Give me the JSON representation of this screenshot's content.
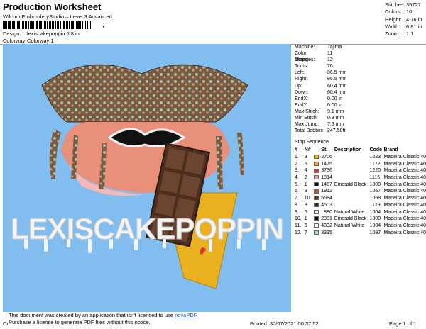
{
  "header": {
    "title": "Production Worksheet",
    "subtitle": "Wilcom EmbroideryStudio – Level 3 Advanced",
    "comma": ",",
    "design_label": "Design:",
    "design_value": "lexiscakepoppin 6,8 in",
    "colorway_label": "Colorway:",
    "colorway_value": "Colorway 1"
  },
  "stats": [
    {
      "label": "Stitches:",
      "value": "35727"
    },
    {
      "label": "Colors:",
      "value": "10"
    },
    {
      "label": "Height:",
      "value": "4.76 in"
    },
    {
      "label": "Width:",
      "value": "6.81 in"
    },
    {
      "label": "Zoom:",
      "value": "1:1"
    }
  ],
  "machine_info": [
    {
      "label": "Machine:",
      "value": "Tajima"
    },
    {
      "label": "Color changes:",
      "value": "11"
    },
    {
      "label": "Stops:",
      "value": "12"
    },
    {
      "label": "Trims:",
      "value": "70"
    },
    {
      "label": "Left:",
      "value": "86.5 mm"
    },
    {
      "label": "Right:",
      "value": "86.5 mm"
    },
    {
      "label": "Up:",
      "value": "60.4 mm"
    },
    {
      "label": "Down:",
      "value": "60.4 mm"
    },
    {
      "label": "EndX:",
      "value": "0.00 in"
    },
    {
      "label": "EndY:",
      "value": "0.00 in"
    },
    {
      "label": "Max Stitch:",
      "value": "9.1 mm"
    },
    {
      "label": "Min Stitch:",
      "value": "0.3 mm"
    },
    {
      "label": "Max Jump:",
      "value": "7.3 mm"
    },
    {
      "label": "Total Bobbin:",
      "value": "247.58ft"
    }
  ],
  "stop_sequence": {
    "title": "Stop Sequence:",
    "headers": [
      "#",
      "N#",
      "St.",
      "Description",
      "Code",
      "Brand"
    ],
    "rows": [
      {
        "num": "1.",
        "n": "3",
        "color": "#f0b400",
        "st": "2706",
        "desc": "",
        "code": "1223",
        "brand": "Madeira Classic 40"
      },
      {
        "num": "2.",
        "n": "5",
        "color": "#f29d2b",
        "st": "1475",
        "desc": "",
        "code": "1172",
        "brand": "Madeira Classic 40"
      },
      {
        "num": "3.",
        "n": "4",
        "color": "#e0373d",
        "st": "3736",
        "desc": "",
        "code": "1220",
        "brand": "Madeira Classic 40"
      },
      {
        "num": "4.",
        "n": "2",
        "color": "#f2a2b0",
        "st": "1814",
        "desc": "",
        "code": "1116",
        "brand": "Madeira Classic 40"
      },
      {
        "num": "5.",
        "n": "1",
        "color": "#0a0a0a",
        "st": "1487",
        "desc": "Emerald Black",
        "code": "1000",
        "brand": "Madeira Classic 40"
      },
      {
        "num": "6.",
        "n": "9",
        "color": "#b5553a",
        "st": "1912",
        "desc": "",
        "code": "1057",
        "brand": "Madeira Classic 40"
      },
      {
        "num": "7.",
        "n": "10",
        "color": "#5a3a22",
        "st": "6684",
        "desc": "",
        "code": "1058",
        "brand": "Madeira Classic 40"
      },
      {
        "num": "8.",
        "n": "8",
        "color": "#3e2a1c",
        "st": "4503",
        "desc": "",
        "code": "1129",
        "brand": "Madeira Classic 40"
      },
      {
        "num": "9.",
        "n": "6",
        "color": "#ffffff",
        "st": "880",
        "desc": "Natural White",
        "code": "1004",
        "brand": "Madeira Classic 40"
      },
      {
        "num": "10.",
        "n": "1",
        "color": "#0a0a0a",
        "st": "2381",
        "desc": "Emerald Black",
        "code": "1000",
        "brand": "Madeira Classic 40"
      },
      {
        "num": "11.",
        "n": "6",
        "color": "#ffffff",
        "st": "4832",
        "desc": "Natural White",
        "code": "1004",
        "brand": "Madeira Classic 40"
      },
      {
        "num": "12.",
        "n": "7",
        "color": "#9fe3d2",
        "st": "3315",
        "desc": "",
        "code": "1097",
        "brand": "Madeira Classic 40"
      }
    ]
  },
  "design_preview": {
    "text": "LEXISCAKEPOPPIN",
    "background": "#82bdf0"
  },
  "footer": {
    "notice_line1": "This document was created by an application that isn't licensed to use ",
    "notice_link": "novaPDF",
    "notice_end": ".",
    "notice_line2": "Purchase a license to generate PDF files without this notice.",
    "cr": "Cr",
    "printed": "Printed: 30/07/2021 00:37:52",
    "page": "Page 1 of 1"
  }
}
